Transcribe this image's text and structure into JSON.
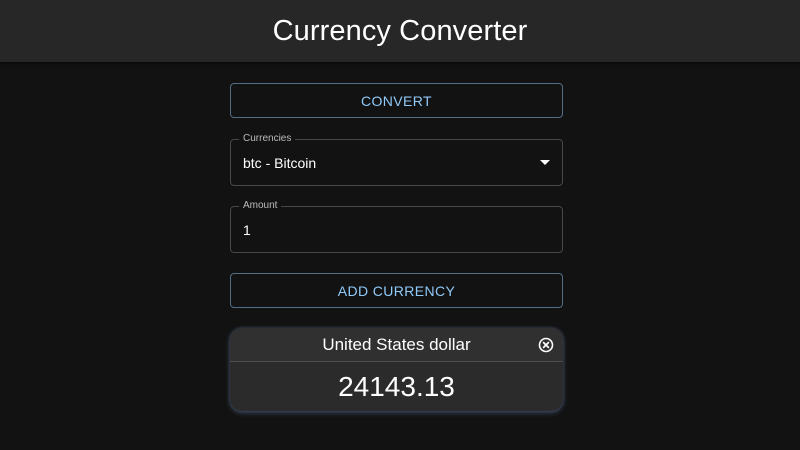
{
  "header": {
    "title": "Currency Converter"
  },
  "convert_button": {
    "label": "CONVERT"
  },
  "currency_select": {
    "label": "Currencies",
    "value": "btc - Bitcoin",
    "icon": "dropdown-arrow-icon"
  },
  "amount_input": {
    "label": "Amount",
    "value": "1"
  },
  "add_currency_button": {
    "label": "ADD CURRENCY"
  },
  "result_cards": [
    {
      "currency_name": "United States dollar",
      "value": "24143.13",
      "close_icon": "close-circle-icon"
    }
  ],
  "colors": {
    "accent": "#90caf9",
    "background": "#121212",
    "app_bar": "#272727",
    "card": "#2b2b2b"
  }
}
